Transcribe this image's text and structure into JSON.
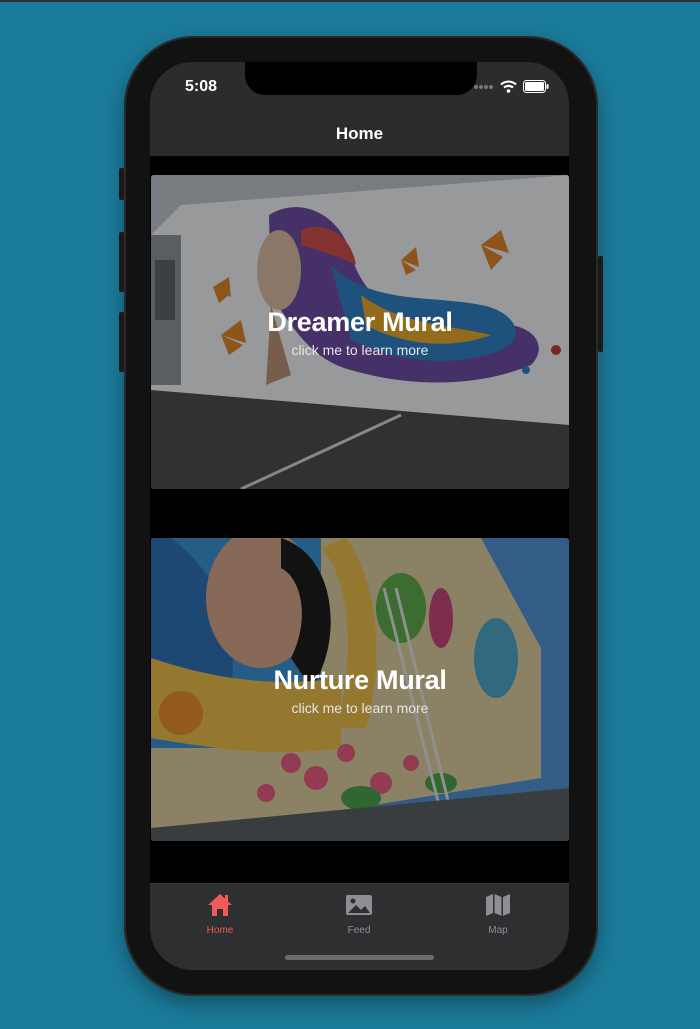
{
  "status_bar": {
    "time": "5:08"
  },
  "nav": {
    "title": "Home"
  },
  "murals": [
    {
      "title": "Dreamer Mural",
      "subtitle": "click me to learn more"
    },
    {
      "title": "Nurture Mural",
      "subtitle": "click me to learn more"
    }
  ],
  "tabs": [
    {
      "label": "Home",
      "icon": "home-icon",
      "active": true
    },
    {
      "label": "Feed",
      "icon": "photo-icon",
      "active": false
    },
    {
      "label": "Map",
      "icon": "map-icon",
      "active": false
    }
  ],
  "colors": {
    "background": "#1b7b9a",
    "active_tab": "#f05a5a",
    "inactive_tab": "#8e8e93"
  }
}
